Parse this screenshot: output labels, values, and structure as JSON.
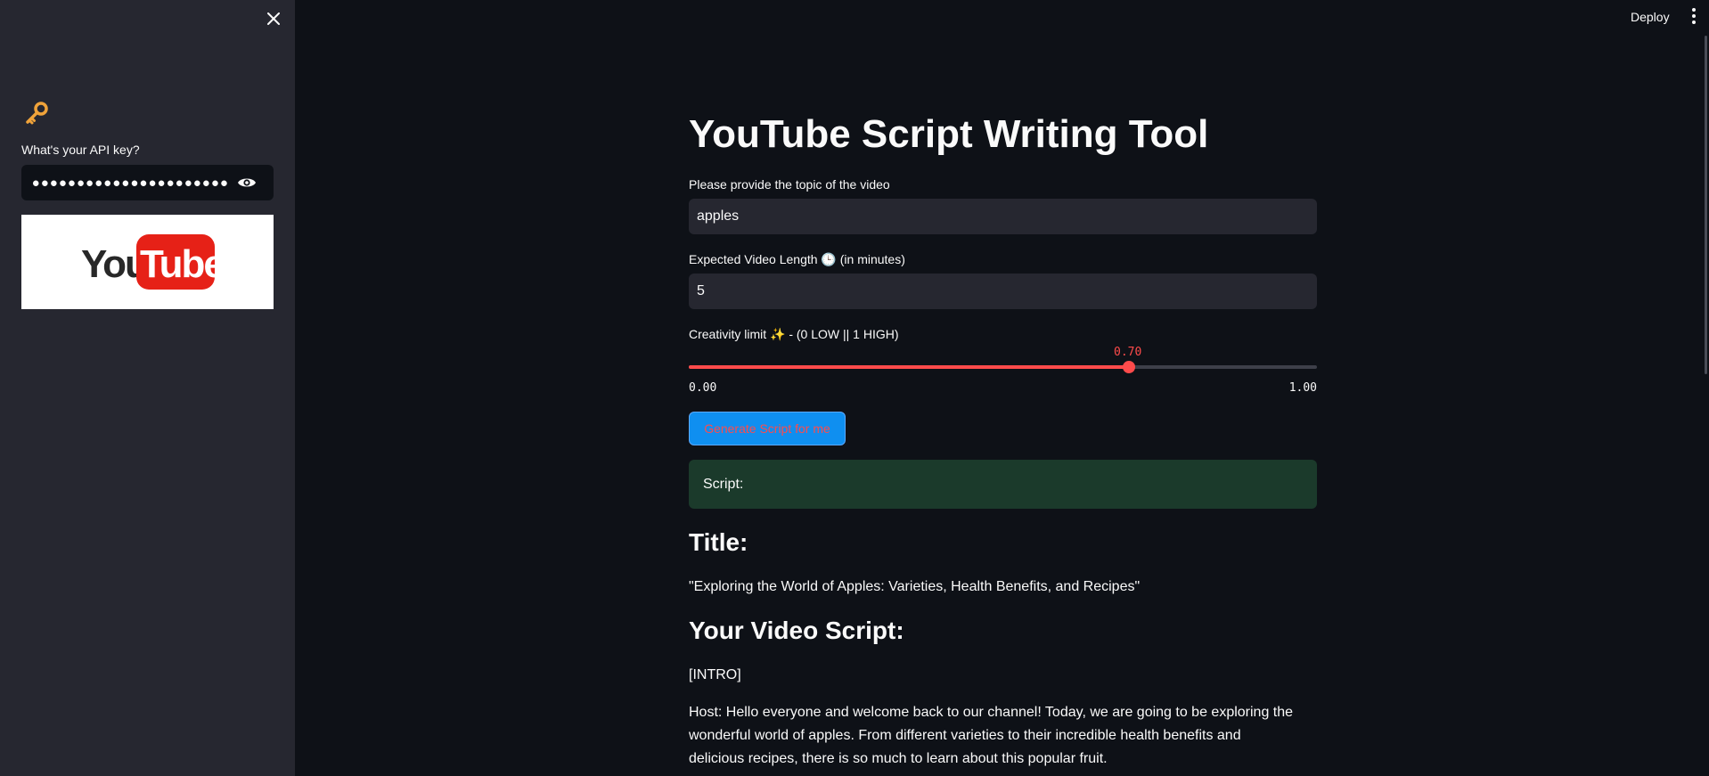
{
  "sidebar": {
    "close_icon": "close-icon",
    "key_icon": "key-icon",
    "api_label": "What's your API key?",
    "api_value": "●●●●●●●●●●●●●●●●●●●●●●●●●●●●●●●●●●●●",
    "eye_icon": "eye-icon",
    "logo_text_you": "You",
    "logo_text_tube": "Tube"
  },
  "header": {
    "deploy_label": "Deploy",
    "menu_icon": "vertical-dots-icon"
  },
  "main": {
    "title": "YouTube Script Writing Tool",
    "topic_label": "Please provide the topic of the video",
    "topic_value": "apples",
    "length_label_prefix": "Expected Video Length",
    "length_label_emoji": "🕒",
    "length_label_suffix": "(in minutes)",
    "length_value": "5",
    "creativity_label_prefix": "Creativity limit",
    "creativity_label_emoji": "✨",
    "creativity_label_suffix": "- (0 LOW || 1 HIGH)",
    "slider": {
      "value": 0.7,
      "value_label": "0.70",
      "min": 0.0,
      "max": 1.0,
      "min_label": "0.00",
      "max_label": "1.00"
    },
    "generate_button_label": "Generate Script for me",
    "script_box_label": "Script:",
    "title_heading": "Title:",
    "video_title": "\"Exploring the World of Apples: Varieties, Health Benefits, and Recipes\"",
    "script_heading": "Your Video Script:",
    "intro_tag": "[INTRO]",
    "host_paragraph": "Host: Hello everyone and welcome back to our channel! Today, we are going to be exploring the wonderful world of apples. From different varieties to their incredible health benefits and delicious recipes, there is so much to learn about this popular fruit."
  },
  "colors": {
    "background": "#0e1117",
    "sidebar": "#262730",
    "accent": "#ff4b4b",
    "button": "#0f8ff0",
    "success_box": "#1b3a2b"
  }
}
